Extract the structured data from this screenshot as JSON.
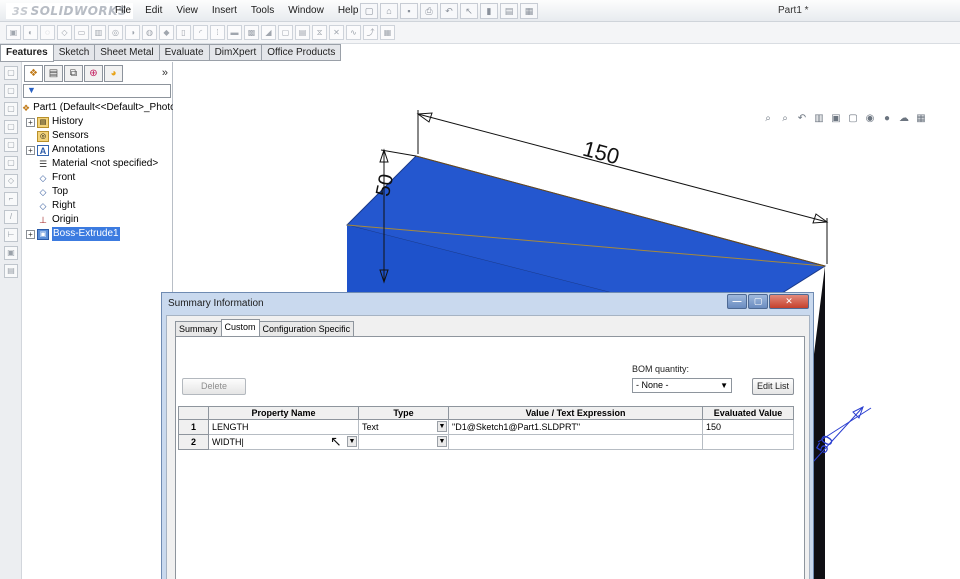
{
  "app": {
    "logo": "SOLIDWORKS",
    "window_title": "Part1 *"
  },
  "menu": [
    "File",
    "Edit",
    "View",
    "Insert",
    "Tools",
    "Window",
    "Help"
  ],
  "command_tabs": [
    "Features",
    "Sketch",
    "Sheet Metal",
    "Evaluate",
    "DimXpert",
    "Office Products"
  ],
  "feature_tree": {
    "root": "Part1  (Default<<Default>_Photo",
    "items": [
      {
        "label": "History",
        "icon": "history-icon"
      },
      {
        "label": "Sensors",
        "icon": "sensors-icon"
      },
      {
        "label": "Annotations",
        "icon": "annotations-icon"
      },
      {
        "label": "Material <not specified>",
        "icon": "material-icon"
      },
      {
        "label": "Front",
        "icon": "plane-icon"
      },
      {
        "label": "Top",
        "icon": "plane-icon"
      },
      {
        "label": "Right",
        "icon": "plane-icon"
      },
      {
        "label": "Origin",
        "icon": "origin-icon"
      },
      {
        "label": "Boss-Extrude1",
        "icon": "boss-extrude-icon"
      }
    ]
  },
  "model": {
    "dim_length": "150",
    "dim_height": "50",
    "dim_partial": "50",
    "color": "#1f55c8"
  },
  "dialog": {
    "title": "Summary Information",
    "tabs": [
      "Summary",
      "Custom",
      "Configuration Specific"
    ],
    "delete_label": "Delete",
    "bom_label": "BOM quantity:",
    "bom_value": "- None -",
    "edit_list_label": "Edit List",
    "columns": [
      "",
      "Property Name",
      "Type",
      "Value / Text Expression",
      "Evaluated Value"
    ],
    "rows": [
      {
        "num": "1",
        "name": "LENGTH",
        "type": "Text",
        "value": "\"D1@Sketch1@Part1.SLDPRT\"",
        "evaluated": "150"
      },
      {
        "num": "2",
        "name": "WIDTH",
        "type": "",
        "value": "",
        "evaluated": ""
      }
    ]
  }
}
